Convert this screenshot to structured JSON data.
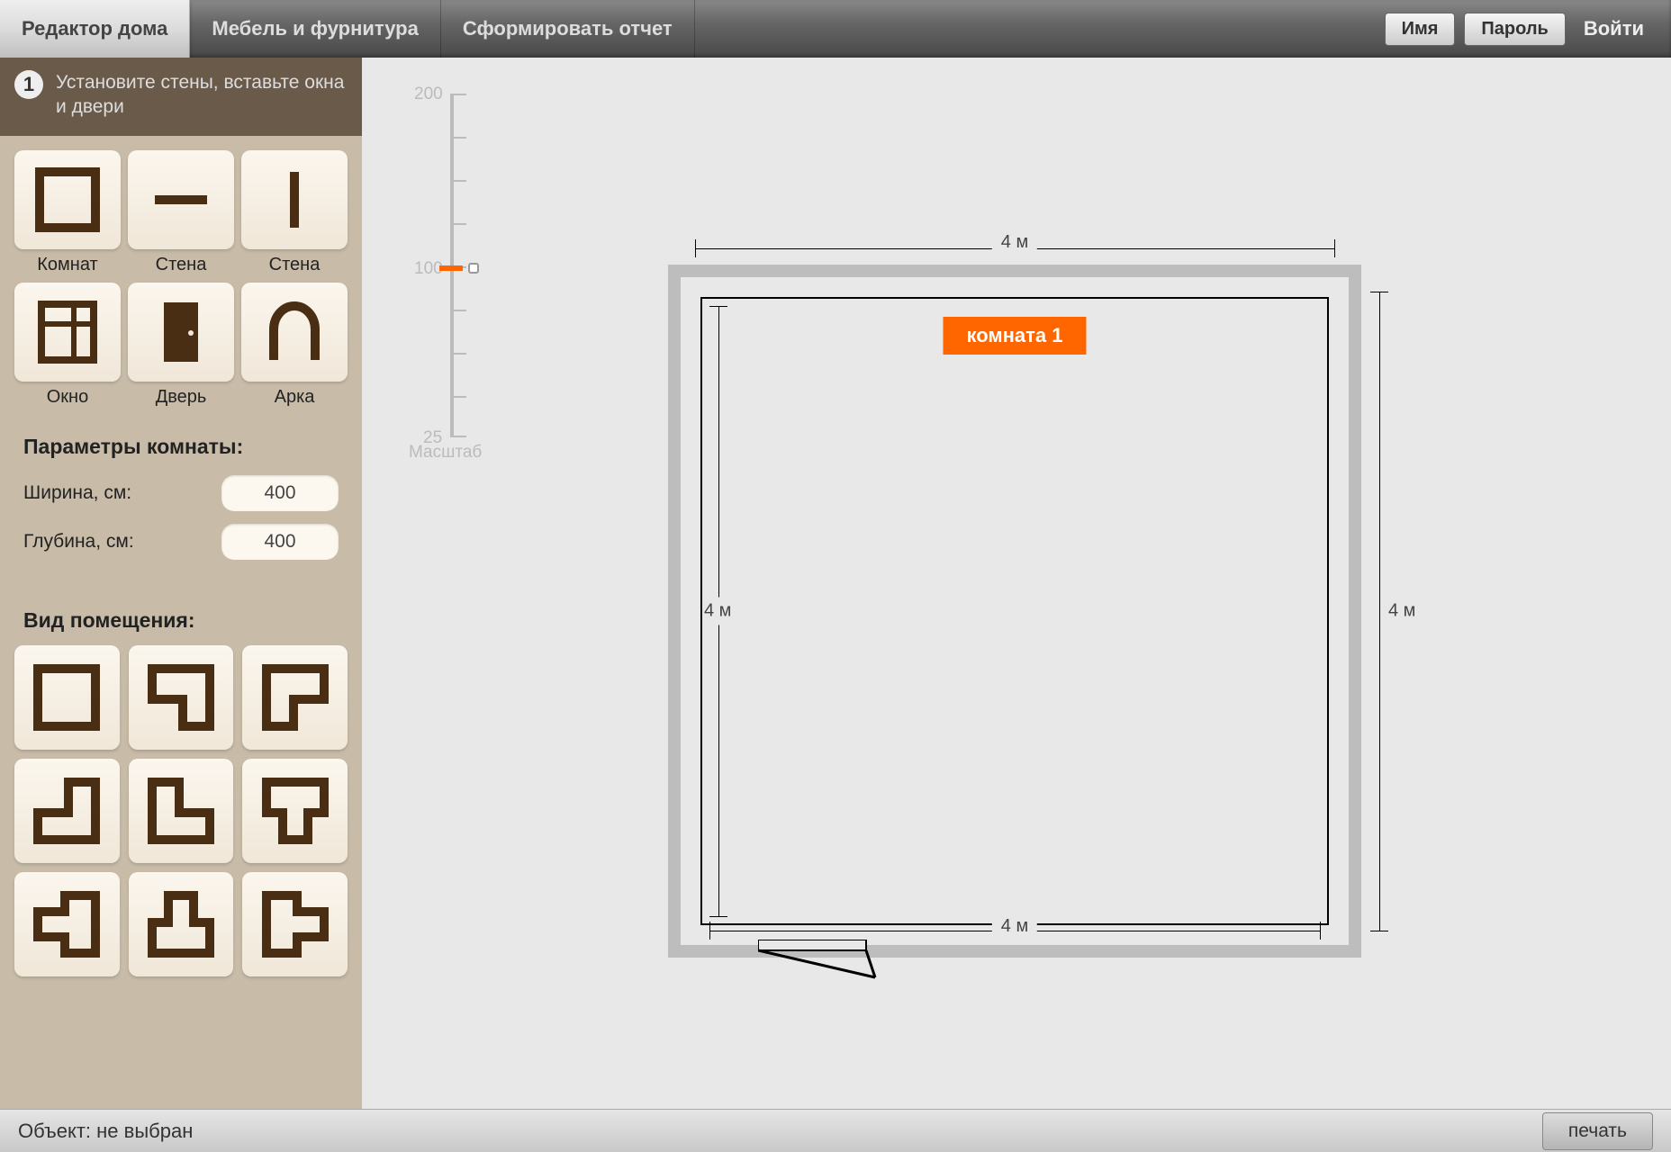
{
  "topbar": {
    "tabs": [
      {
        "label": "Редактор дома",
        "active": true
      },
      {
        "label": "Мебель и фурнитура",
        "active": false
      },
      {
        "label": "Сформировать отчет",
        "active": false
      }
    ],
    "name_btn": "Имя",
    "password_btn": "Пароль",
    "login_link": "Войти"
  },
  "step": {
    "number": "1",
    "text": "Установите стены, вставьте окна и двери"
  },
  "tools": [
    {
      "label": "Комнат",
      "icon": "room"
    },
    {
      "label": "Стена",
      "icon": "wall-h"
    },
    {
      "label": "Стена",
      "icon": "wall-v"
    },
    {
      "label": "Окно",
      "icon": "window"
    },
    {
      "label": "Дверь",
      "icon": "door"
    },
    {
      "label": "Арка",
      "icon": "arch"
    }
  ],
  "params": {
    "title": "Параметры комнаты:",
    "width_label": "Ширина, см:",
    "width_value": "400",
    "depth_label": "Глубина, см:",
    "depth_value": "400"
  },
  "shapes": {
    "title": "Вид помещения:"
  },
  "zoom": {
    "max": "200",
    "mid": "100",
    "min": "25",
    "caption": "Масштаб"
  },
  "room": {
    "label": "комната 1",
    "dim_top": "4 м",
    "dim_right": "4 м",
    "dim_bottom": "4 м",
    "dim_left": "4 м"
  },
  "statusbar": {
    "text": "Объект: не выбран",
    "print": "печать"
  }
}
